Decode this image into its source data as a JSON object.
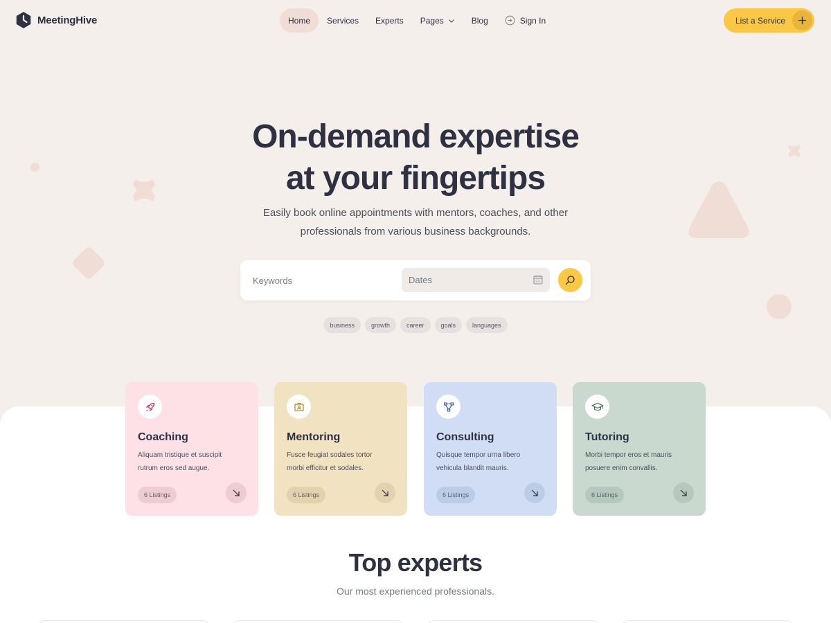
{
  "brand": {
    "name": "MeetingHive"
  },
  "nav": {
    "items": [
      {
        "label": "Home",
        "active": true
      },
      {
        "label": "Services"
      },
      {
        "label": "Experts"
      },
      {
        "label": "Pages",
        "icon": "chevron-down-icon"
      },
      {
        "label": "Blog"
      },
      {
        "label": "Sign In",
        "icon": "sign-in-icon"
      }
    ],
    "cta_label": "List a Service"
  },
  "hero": {
    "title_line1": "On-demand expertise",
    "title_line2": "at your fingertips",
    "subtitle_line1": "Easily book online appointments with mentors, coaches, and other",
    "subtitle_line2": "professionals from various business backgrounds."
  },
  "search": {
    "keywords_placeholder": "Keywords",
    "dates_placeholder": "Dates",
    "tags": [
      "business",
      "growth",
      "career",
      "goals",
      "languages"
    ]
  },
  "categories": [
    {
      "title": "Coaching",
      "line1": "Aliquam tristique et suscipit",
      "line2": "rutrum eros sed augue.",
      "listings": "6 Listings",
      "icon": "rocket-icon",
      "bg": "#fde1e7"
    },
    {
      "title": "Mentoring",
      "line1": "Fusce feugiat sodales tortor",
      "line2": "morbi efficitur et sodales.",
      "listings": "6 Listings",
      "icon": "id-badge-icon",
      "bg": "#f1e2c1"
    },
    {
      "title": "Consulting",
      "line1": "Quisque tempor urna libero",
      "line2": "vehicula blandit mauris.",
      "listings": "6 Listings",
      "icon": "network-icon",
      "bg": "#d0ddf5"
    },
    {
      "title": "Tutoring",
      "line1": "Morbi tempor eros et mauris",
      "line2": "posuere enim convallis.",
      "listings": "6 Listings",
      "icon": "graduation-cap-icon",
      "bg": "#c9d9cf"
    }
  ],
  "experts": {
    "title": "Top experts",
    "subtitle": "Our most experienced professionals."
  },
  "colors": {
    "accent": "#fbc845",
    "hero_bg": "#f5efec",
    "text": "#2d3142"
  }
}
